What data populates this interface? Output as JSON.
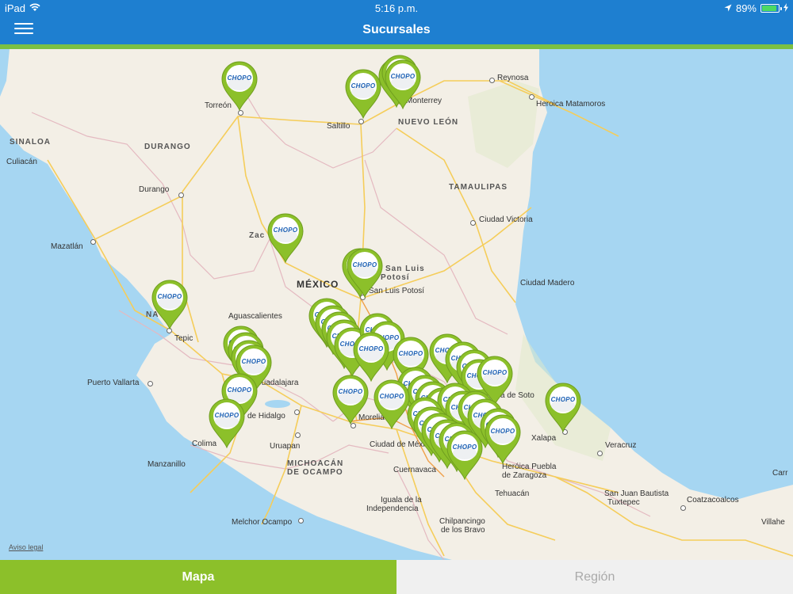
{
  "status_bar": {
    "carrier": "iPad",
    "time": "5:16 p.m.",
    "battery": "89%",
    "battery_level": 0.89
  },
  "nav": {
    "title": "Sucursales"
  },
  "pin_logo": "CHOPO",
  "map": {
    "labels": {
      "sinaloa": "SINALOA",
      "durango_state": "DURANGO",
      "nuevo_leon": "NUEVO LEÓN",
      "tamaulipas": "TAMAULIPAS",
      "mexico": "MÉXICO",
      "michoacan_1": "MICHOACÁN",
      "michoacan_2": "DE OCAMPO",
      "torreon": "Torreón",
      "saltillo": "Saltillo",
      "monterrey": "Monterrey",
      "reynosa": "Reynosa",
      "matamoros": "Heroica Matamoros",
      "culiacan": "Culiacán",
      "durango": "Durango",
      "mazatlan": "Mazatlán",
      "zacatecas": "Zac",
      "ciudad_victoria": "Ciudad Victoria",
      "ciudad_madero": "Ciudad Madero",
      "slp_1": "San Luis",
      "slp_2": "Potosí",
      "slp_city": "San Luis Potosí",
      "nayarit": "NA",
      "tepic": "Tepic",
      "aguascalientes": "Aguascalientes",
      "puerto_vallarta": "Puerto Vallarta",
      "guadalajara": "Guadalajara",
      "hidalgo": "de Hidalgo",
      "colima": "Colima",
      "manzanillo": "Manzanillo",
      "uruapan": "Uruapan",
      "morelia": "Morelia",
      "ciudad_mexico": "Ciudad de México",
      "cuernavaca": "Cuernavaca",
      "puebla_1": "Heróica Puebla",
      "puebla_2": "de Zaragoza",
      "xalapa": "Xalapa",
      "veracruz": "Veracruz",
      "tehuacan": "Tehuacán",
      "soto": "ca de Soto",
      "sjb_1": "San Juan Bautista",
      "sjb_2": "Tuxtepec",
      "coatzacoalcos": "Coatzacoalcos",
      "villahermosa": "Villahe",
      "iguala_1": "Iguala de la",
      "iguala_2": "Independencia",
      "chilpancingo_1": "Chilpancingo",
      "chilpancingo_2": "de los Bravo",
      "melchor": "Melchor Ocampo",
      "carr": "Carr"
    }
  },
  "legal": "Aviso legal",
  "tabs": {
    "map": "Mapa",
    "region": "Región"
  },
  "colors": {
    "brand_blue": "#1e7fd0",
    "brand_green": "#8cc02a",
    "pin_green": "#8cc02a",
    "sea": "#a6d6f2"
  }
}
